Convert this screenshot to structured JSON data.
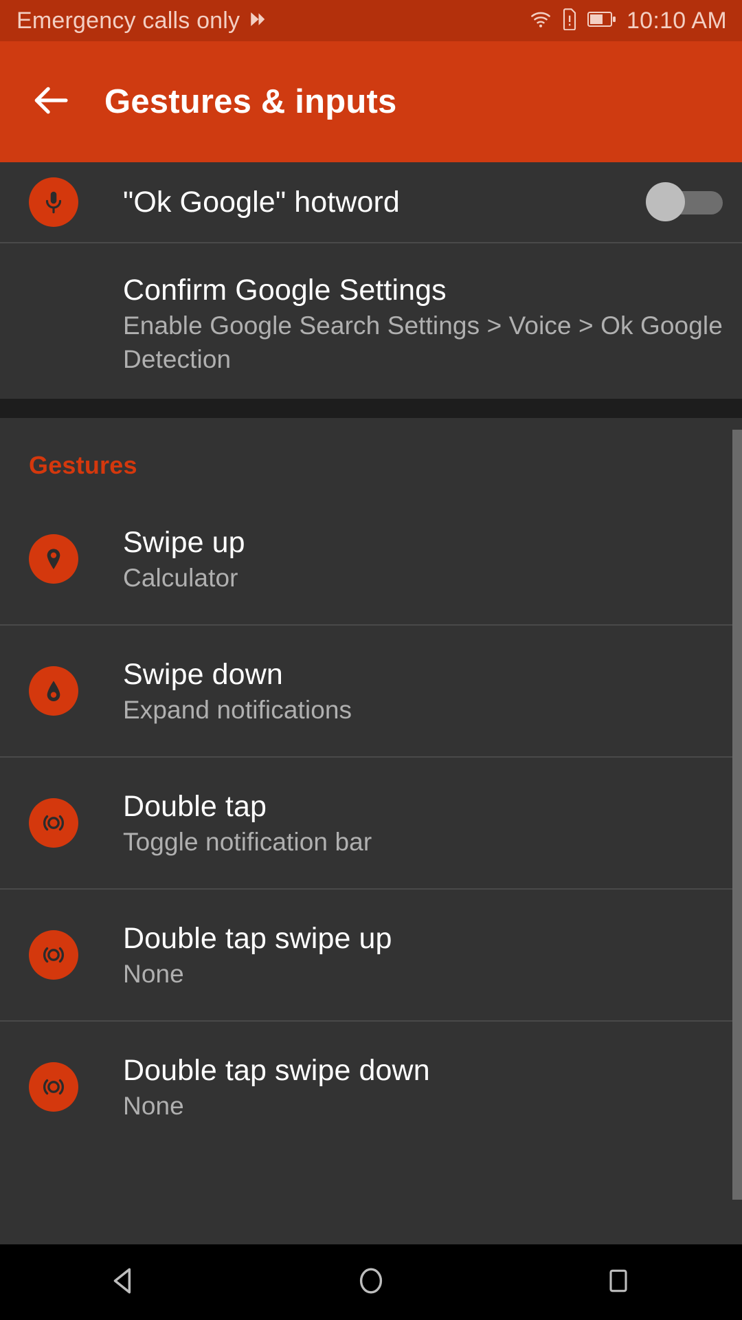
{
  "status_bar": {
    "carrier_text": "Emergency calls only",
    "carrier_icon": "double-chevron-right-icon",
    "wifi_icon": "wifi-icon",
    "sim_icon": "sim-card-alert-icon",
    "battery_icon": "battery-icon",
    "time": "10:10 AM"
  },
  "app_bar": {
    "back_icon": "arrow-left-icon",
    "title": "Gestures & inputs",
    "background": "#cf3b11"
  },
  "colors": {
    "accent": "#d4380d",
    "status_bar_bg": "#b3300c",
    "page_bg": "#333333",
    "title_text": "#ffffff",
    "subtitle_text": "#b0b0b0"
  },
  "voice_section": {
    "hotword": {
      "icon": "microphone-icon",
      "title": "\"Ok Google\" hotword",
      "toggle_state": "off"
    },
    "confirm": {
      "title": "Confirm Google Settings",
      "subtitle": "Enable Google Search Settings > Voice > Ok Google Detection"
    }
  },
  "gestures_section": {
    "header": "Gestures",
    "items": [
      {
        "icon": "location-pin-up-icon",
        "title": "Swipe up",
        "subtitle": "Calculator"
      },
      {
        "icon": "water-drop-icon",
        "title": "Swipe down",
        "subtitle": "Expand notifications"
      },
      {
        "icon": "tap-ripple-icon",
        "title": "Double tap",
        "subtitle": "Toggle notification bar"
      },
      {
        "icon": "tap-ripple-icon",
        "title": "Double tap swipe up",
        "subtitle": "None"
      },
      {
        "icon": "tap-ripple-icon",
        "title": "Double tap swipe down",
        "subtitle": "None"
      }
    ]
  },
  "nav_bar": {
    "back_icon": "nav-back-triangle-icon",
    "home_icon": "nav-home-circle-icon",
    "recents_icon": "nav-recents-square-icon"
  }
}
